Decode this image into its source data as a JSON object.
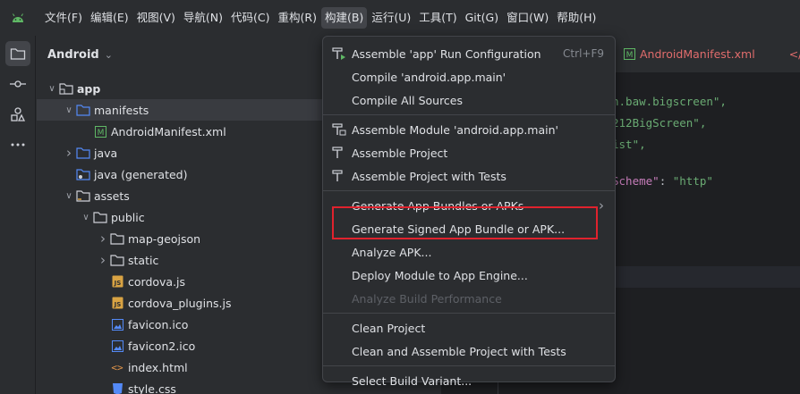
{
  "menubar": {
    "items": [
      "文件(F)",
      "编辑(E)",
      "视图(V)",
      "导航(N)",
      "代码(C)",
      "重构(R)",
      "构建(B)",
      "运行(U)",
      "工具(T)",
      "Git(G)",
      "窗口(W)",
      "帮助(H)"
    ],
    "active_index": 6
  },
  "project": {
    "title": "Android",
    "tree": [
      {
        "label": "app",
        "kind": "module",
        "arrow": "down",
        "indent": 0,
        "bold": true
      },
      {
        "label": "manifests",
        "kind": "folder-blue",
        "arrow": "down",
        "indent": 1,
        "selected": true
      },
      {
        "label": "AndroidManifest.xml",
        "kind": "manifest",
        "arrow": "",
        "indent": 2
      },
      {
        "label": "java",
        "kind": "folder-blue",
        "arrow": "right",
        "indent": 1
      },
      {
        "label": "java (generated)",
        "kind": "folder-gen",
        "arrow": "",
        "indent": 1
      },
      {
        "label": "assets",
        "kind": "folder-assets",
        "arrow": "down",
        "indent": 1
      },
      {
        "label": "public",
        "kind": "folder",
        "arrow": "down",
        "indent": 2
      },
      {
        "label": "map-geojson",
        "kind": "folder",
        "arrow": "right",
        "indent": 3
      },
      {
        "label": "static",
        "kind": "folder",
        "arrow": "right",
        "indent": 3
      },
      {
        "label": "cordova.js",
        "kind": "js",
        "arrow": "",
        "indent": 3
      },
      {
        "label": "cordova_plugins.js",
        "kind": "js",
        "arrow": "",
        "indent": 3
      },
      {
        "label": "favicon.ico",
        "kind": "image",
        "arrow": "",
        "indent": 3
      },
      {
        "label": "favicon2.ico",
        "kind": "image",
        "arrow": "",
        "indent": 3
      },
      {
        "label": "index.html",
        "kind": "html",
        "arrow": "",
        "indent": 3
      },
      {
        "label": "style.css",
        "kind": "css",
        "arrow": "",
        "indent": 3
      }
    ]
  },
  "editor": {
    "tab_label": "AndroidManifest.xml",
    "code_lines": [
      {
        "text": "n.baw.bigscreen\",",
        "kind": "str"
      },
      {
        "text": "212BigScreen\",",
        "kind": "str"
      },
      {
        "text": "ist\",",
        "kind": "str"
      },
      {
        "text": "Scheme\": \"http\"",
        "kind": "mixed"
      }
    ]
  },
  "build_menu": {
    "items": [
      {
        "label": "Assemble 'app' Run Configuration",
        "icon": "hammer-run",
        "shortcut": "Ctrl+F9"
      },
      {
        "label": "Compile 'android.app.main'",
        "icon": ""
      },
      {
        "label": "Compile All Sources",
        "icon": ""
      },
      {
        "sep": true
      },
      {
        "label": "Assemble Module 'android.app.main'",
        "icon": "hammer-module"
      },
      {
        "label": "Assemble Project",
        "icon": "hammer"
      },
      {
        "label": "Assemble Project with Tests",
        "icon": "hammer"
      },
      {
        "sep": true
      },
      {
        "label": "Generate App Bundles or APKs",
        "icon": "",
        "submenu": true
      },
      {
        "label": "Generate Signed App Bundle or APK...",
        "icon": "",
        "highlighted": true
      },
      {
        "label": "Analyze APK...",
        "icon": ""
      },
      {
        "label": "Deploy Module to App Engine...",
        "icon": ""
      },
      {
        "label": "Analyze Build Performance",
        "icon": "",
        "disabled": true
      },
      {
        "sep": true
      },
      {
        "label": "Clean Project",
        "icon": ""
      },
      {
        "label": "Clean and Assemble Project with Tests",
        "icon": ""
      },
      {
        "sep": true
      },
      {
        "label": "Select Build Variant...",
        "icon": ""
      }
    ]
  },
  "colors": {
    "accent_highlight": "#e0222d",
    "folder_blue": "#548af7",
    "js_yellow": "#d9a343",
    "manifest_green": "#5fb865"
  }
}
